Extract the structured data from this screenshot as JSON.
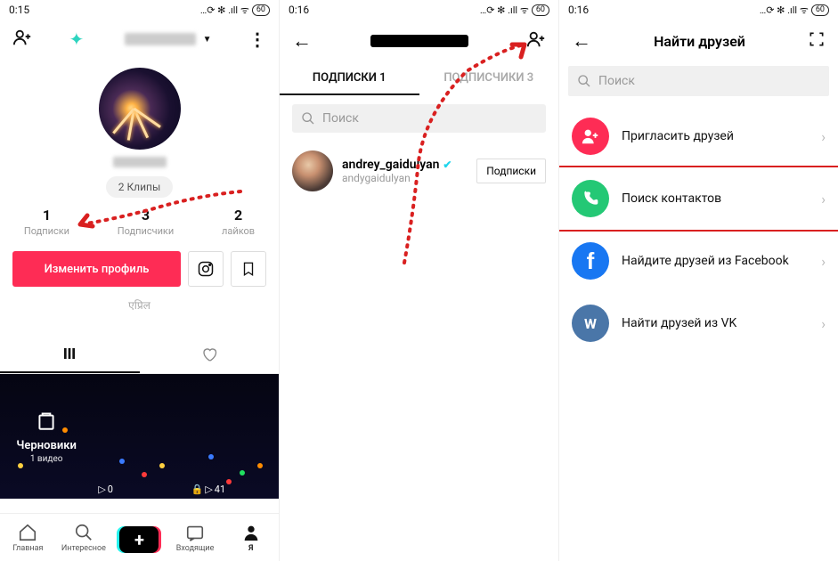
{
  "status": {
    "time1": "0:15",
    "time2": "0:16",
    "time3": "0:16",
    "battery": "60",
    "icons": "…⟳ ✻ .ıll ᯤ"
  },
  "panel1": {
    "clips": "2 Клипы",
    "stats": [
      {
        "n": "1",
        "l": "Подписки"
      },
      {
        "n": "3",
        "l": "Подписчики"
      },
      {
        "n": "2",
        "l": "лайков"
      }
    ],
    "edit": "Изменить профиль",
    "april": "एप्रिल",
    "drafts": "Черновики",
    "drafts_sub": "1 видео",
    "plays": [
      "0",
      "41"
    ],
    "nav": [
      "Главная",
      "Интересное",
      "Входящие",
      "Я"
    ]
  },
  "panel2": {
    "tabs": [
      "ПОДПИСКИ 1",
      "ПОДПИСЧИКИ 3"
    ],
    "search": "Поиск",
    "user": {
      "name": "andrey_gaidulyan",
      "sub": "andygaidulyan"
    },
    "btn": "Подписки"
  },
  "panel3": {
    "title": "Найти друзей",
    "search": "Поиск",
    "rows": [
      "Пригласить друзей",
      "Поиск контактов",
      "Найдите друзей из Facebook",
      "Найти друзей из VK"
    ]
  }
}
